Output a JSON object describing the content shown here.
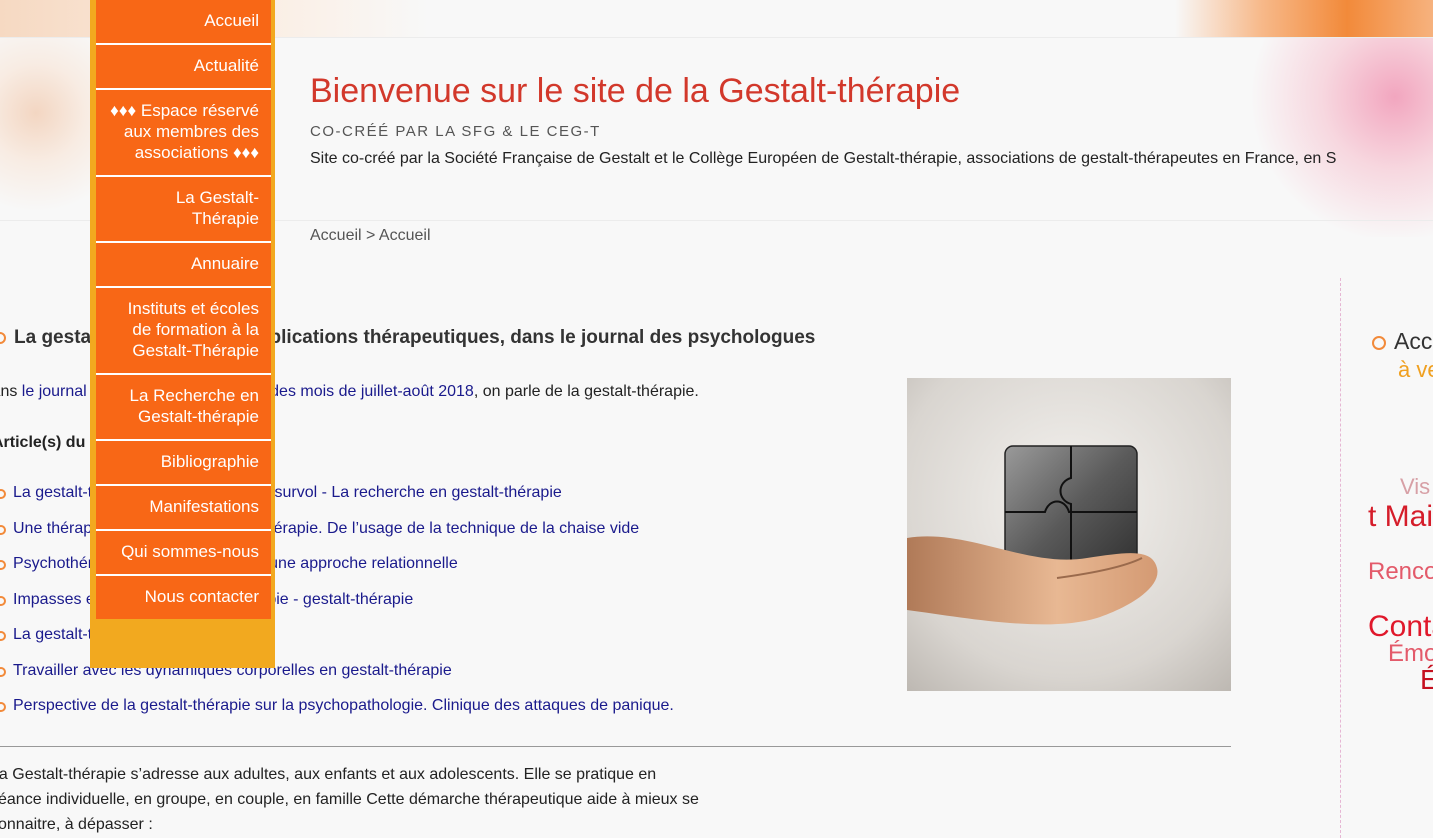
{
  "header": {
    "title": "Bienvenue sur le site de la Gestalt-thérapie",
    "subtitle": "CO-CRÉÉ PAR LA SFG & LE CEG-T",
    "description": "Site co-créé par la Société Française de Gestalt et le Collège Européen de Gestalt-thérapie, associations de gestalt-thérapeutes en France, en S"
  },
  "breadcrumb": "Accueil > Accueil",
  "menu": {
    "items": [
      {
        "label": "Accueil"
      },
      {
        "label": "Actualité"
      },
      {
        "label": "♦♦♦ Espace réservé aux membres des associations ♦♦♦"
      },
      {
        "label": "La Gestalt-Thérapie"
      },
      {
        "label": "Annuaire"
      },
      {
        "label": "Instituts et écoles de formation à la Gestalt-Thérapie"
      },
      {
        "label": "La Recherche en Gestalt-thérapie"
      },
      {
        "label": "Bibliographie"
      },
      {
        "label": "Manifestations"
      },
      {
        "label": "Qui sommes-nous"
      },
      {
        "label": "Nous contacter"
      }
    ]
  },
  "article": {
    "title": "La gestalt-thérapie et ses applications thérapeutiques, dans le journal des psychologues",
    "text_prefix": "Dans ",
    "text_link": "le journal des psychologues n°359 des mois de juillet-août 2018",
    "text_suffix": ", on parle de la gestalt-thérapie.",
    "articles_heading": "Article(s) du dossier :",
    "list": [
      "La gestalt-thérapie en recherche, un survol - La recherche en gestalt-thérapie",
      "Une thérapie de groupe en gestalt-thérapie. De l’usage de la technique de la chaise vide",
      "Psychothérapie et gestalt-thérapie  : une approche relationnelle",
      "Impasses et conflits en psychothérapie - gestalt-thérapie",
      "La gestalt-thérapie avec les enfants",
      "Travailler avec les dynamiques corporelles en gestalt-thérapie",
      "Perspective de la gestalt-thérapie sur la psychopathologie. Clinique des attaques de panique."
    ],
    "intro": "La Gestalt-thérapie s’adresse aux adultes, aux enfants et aux adolescents. Elle se pratique en séance individuelle, en groupe, en couple, en famille Cette démarche thérapeutique aide à mieux se connaitre, à dépasser :",
    "image_alt": "hand-holding-puzzle"
  },
  "sidebar": {
    "title": "Acc",
    "subtitle": "à ve",
    "poster": {
      "line1": "Vis",
      "line2": "t Mai",
      "line3": "Renco",
      "line4": "Conta",
      "line5": "Émo",
      "line6": "É"
    }
  },
  "colors": {
    "accent_orange": "#f86716",
    "menu_border": "#f2a91f",
    "title_red": "#d2382b",
    "link_blue": "#1a1a8c"
  }
}
